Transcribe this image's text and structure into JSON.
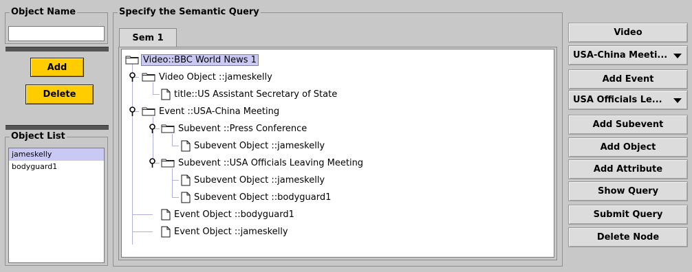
{
  "object_name": {
    "title": "Object Name",
    "value": ""
  },
  "actions": {
    "add_label": "Add",
    "delete_label": "Delete"
  },
  "object_list": {
    "title": "Object List",
    "items": [
      {
        "label": "jameskelly",
        "selected": true
      },
      {
        "label": "bodyguard1",
        "selected": false
      }
    ]
  },
  "semantic_query": {
    "title": "Specify the Semantic Query",
    "tabs": [
      {
        "label": "Sem 1",
        "active": true
      }
    ],
    "tree": [
      {
        "label": "Video::BBC World News 1",
        "type": "folder",
        "selected": true
      },
      {
        "label": "Video Object ::jameskelly",
        "type": "folder",
        "expanded": true
      },
      {
        "label": "title::US Assistant Secretary of State",
        "type": "leaf"
      },
      {
        "label": "Event ::USA-China Meeting",
        "type": "folder",
        "expanded": true
      },
      {
        "label": "Subevent ::Press Conference",
        "type": "folder",
        "expanded": true
      },
      {
        "label": "Subevent Object ::jameskelly",
        "type": "leaf"
      },
      {
        "label": "Subevent ::USA Officials Leaving Meeting",
        "type": "folder",
        "expanded": true
      },
      {
        "label": "Subevent Object ::jameskelly",
        "type": "leaf"
      },
      {
        "label": "Subevent Object ::bodyguard1",
        "type": "leaf"
      },
      {
        "label": "Event Object ::bodyguard1",
        "type": "leaf"
      },
      {
        "label": "Event Object ::jameskelly",
        "type": "leaf"
      }
    ]
  },
  "right_panel": {
    "video_label": "Video",
    "event_select": "USA-China Meeti...",
    "add_event_label": "Add Event",
    "subevent_select": "USA Officials Le...",
    "add_subevent_label": "Add Subevent",
    "add_object_label": "Add Object",
    "add_attribute_label": "Add Attribute",
    "show_query_label": "Show Query",
    "submit_query_label": "Submit Query",
    "delete_node_label": "Delete Node"
  },
  "colors": {
    "background": "#c8c8c8",
    "button_yellow": "#ffcc00",
    "selection": "#c9c9f4"
  }
}
